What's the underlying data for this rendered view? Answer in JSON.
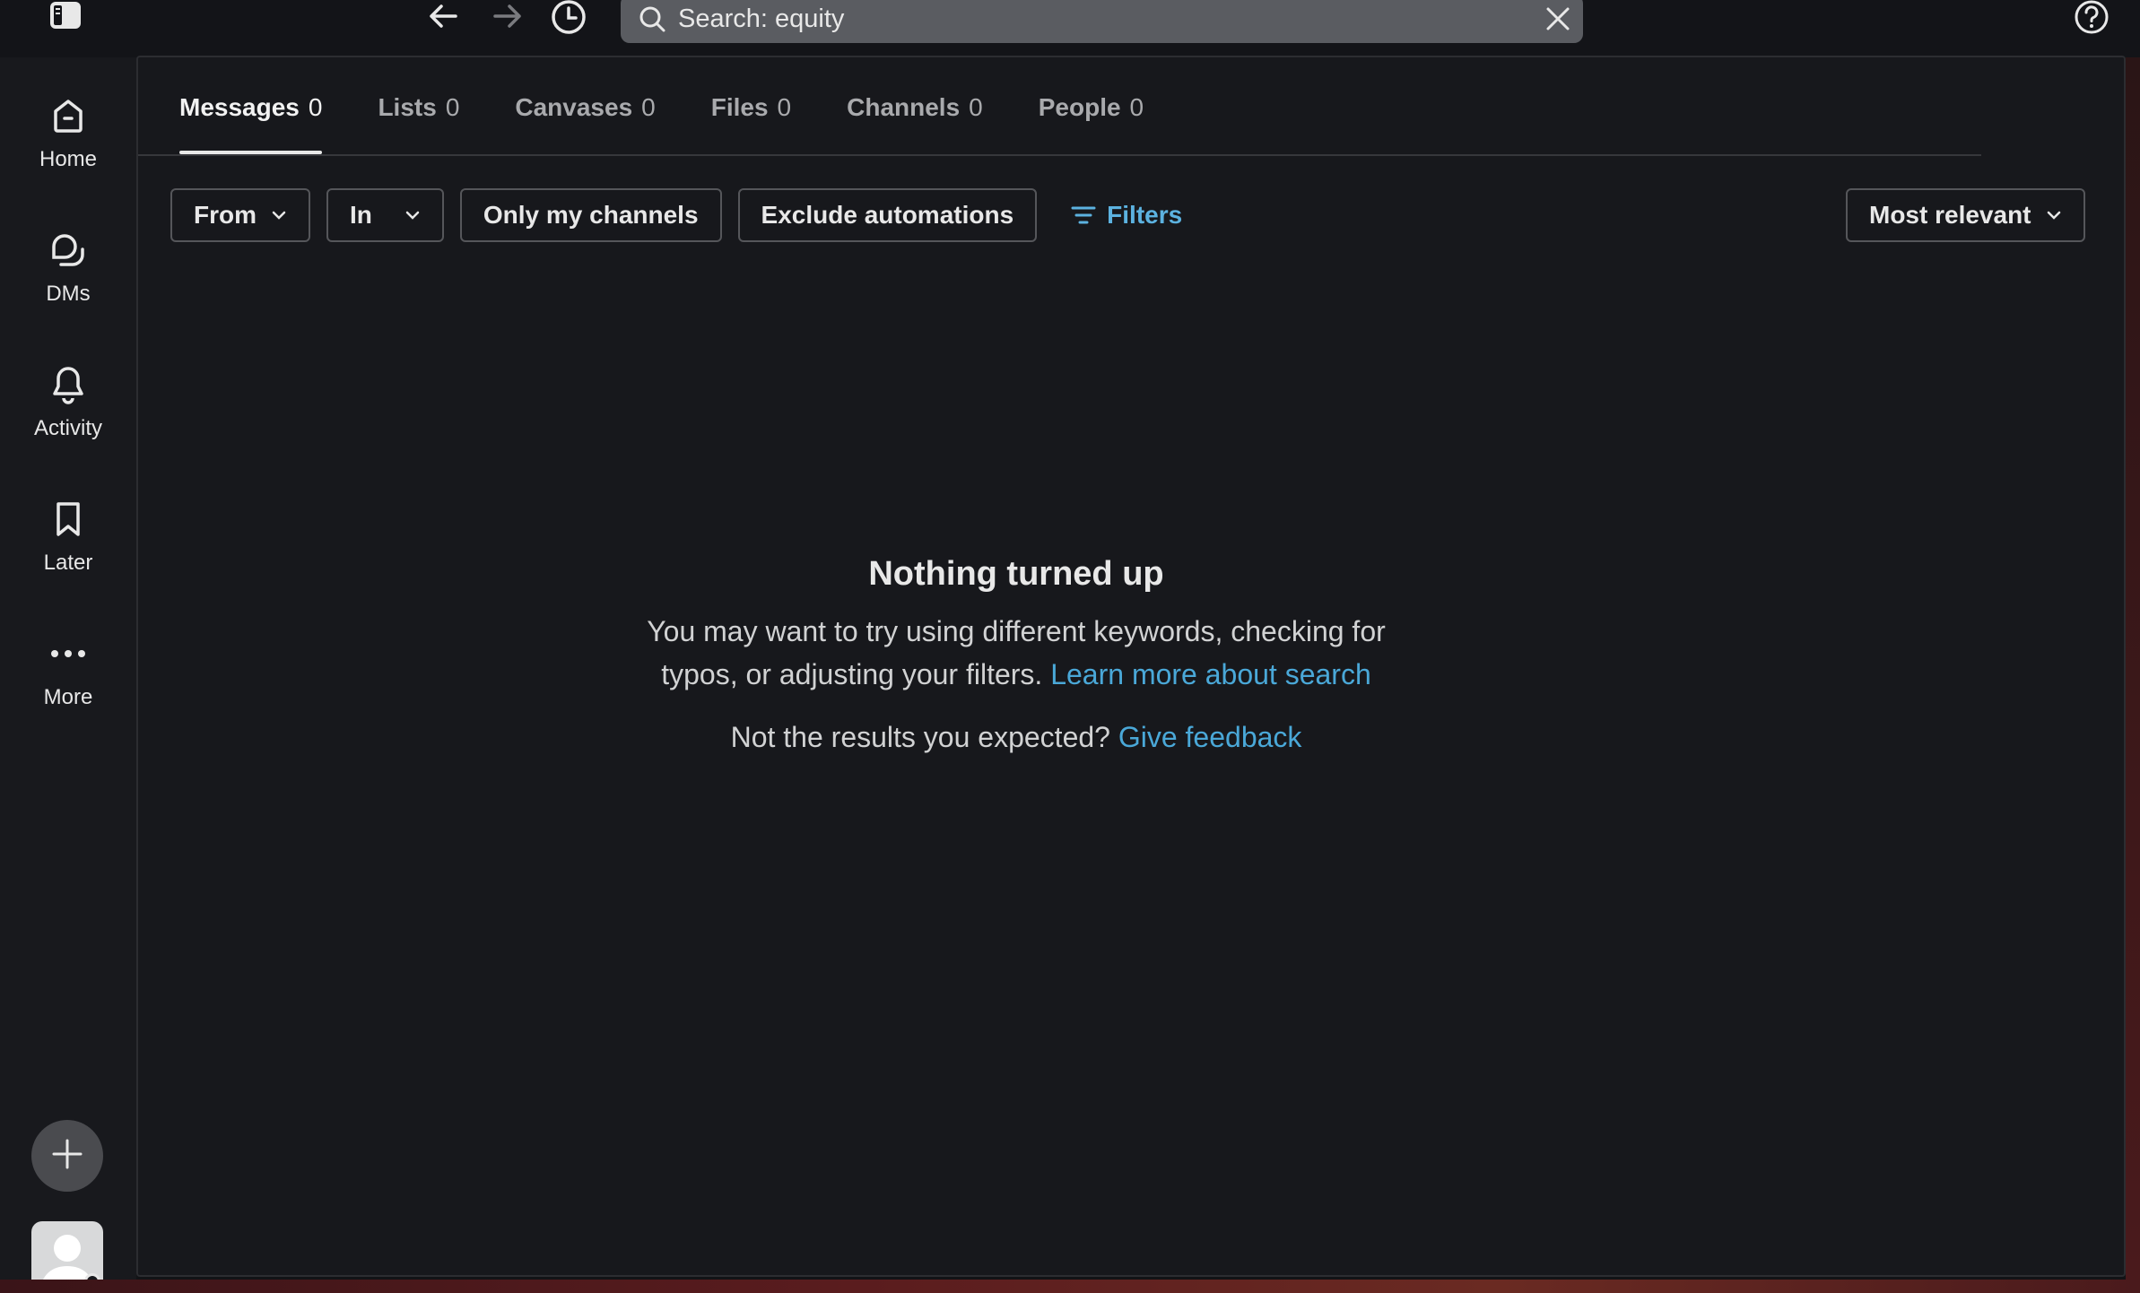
{
  "topbar": {
    "search_text": "Search: equity",
    "icons": [
      "sidebar-toggle-icon",
      "back-arrow-icon",
      "forward-arrow-icon",
      "history-icon",
      "search-icon",
      "close-icon",
      "help-icon"
    ]
  },
  "rail": {
    "items": [
      {
        "label": "Home",
        "icon": "home-icon"
      },
      {
        "label": "DMs",
        "icon": "dms-icon"
      },
      {
        "label": "Activity",
        "icon": "bell-icon"
      },
      {
        "label": "Later",
        "icon": "bookmark-icon"
      },
      {
        "label": "More",
        "icon": "more-icon"
      }
    ]
  },
  "tabs": [
    {
      "label": "Messages",
      "count": "0",
      "active": true
    },
    {
      "label": "Lists",
      "count": "0"
    },
    {
      "label": "Canvases",
      "count": "0"
    },
    {
      "label": "Files",
      "count": "0"
    },
    {
      "label": "Channels",
      "count": "0"
    },
    {
      "label": "People",
      "count": "0"
    }
  ],
  "filters": {
    "from": "From",
    "in": "In",
    "only_my_channels": "Only my channels",
    "exclude_automations": "Exclude automations",
    "filters_link": "Filters",
    "sort": "Most relevant"
  },
  "empty_state": {
    "title": "Nothing turned up",
    "message": "You may want to try using different keywords, checking for typos, or adjusting your filters.",
    "learn_more": "Learn more about search",
    "feedback_prompt": "Not the results you expected?",
    "feedback_link": "Give feedback"
  },
  "colors": {
    "accent_link": "#4aa8d8",
    "background": "#17181c"
  }
}
